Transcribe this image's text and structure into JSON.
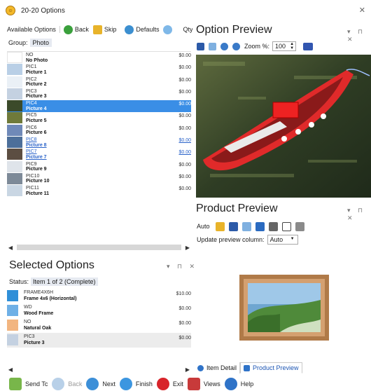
{
  "window": {
    "title": "20-20 Options"
  },
  "toolbar": {
    "tab": "Available Options",
    "back": "Back",
    "skip": "Skip",
    "defaults": "Defaults",
    "qty": "Qty"
  },
  "group": {
    "label": "Group:",
    "value": "Photo"
  },
  "available": [
    {
      "code": "NO",
      "name": "No Photo",
      "price": "$0.00",
      "thumb": "#ffffff",
      "state": ""
    },
    {
      "code": "PIC1",
      "name": "Picture 1",
      "price": "$0.00",
      "thumb": "#b9cfe6",
      "state": ""
    },
    {
      "code": "PIC2",
      "name": "Picture 2",
      "price": "$0.00",
      "thumb": "#eaf0f6",
      "state": ""
    },
    {
      "code": "PIC3",
      "name": "Picture 3",
      "price": "$0.00",
      "thumb": "#c4d1e1",
      "state": ""
    },
    {
      "code": "PIC4",
      "name": "Picture 4",
      "price": "$0.00",
      "thumb": "#3b4a2a",
      "state": "sel"
    },
    {
      "code": "PIC5",
      "name": "Picture 5",
      "price": "$0.00",
      "thumb": "#6f7a3a",
      "state": ""
    },
    {
      "code": "PIC6",
      "name": "Picture 6",
      "price": "$0.00",
      "thumb": "#6f89b8",
      "state": ""
    },
    {
      "code": "PIC8",
      "name": "Picture 8",
      "price": "$0.00",
      "thumb": "#4d6f9a",
      "state": "lnk"
    },
    {
      "code": "PIC7",
      "name": "Picture 7",
      "price": "$0.00",
      "thumb": "#5c4e42",
      "state": "lnk"
    },
    {
      "code": "PIC9",
      "name": "Picture 9",
      "price": "$0.00",
      "thumb": "#dfe4ea",
      "state": ""
    },
    {
      "code": "PIC10",
      "name": "Picture 10",
      "price": "$0.00",
      "thumb": "#7d8a98",
      "state": ""
    },
    {
      "code": "PIC11",
      "name": "Picture 11",
      "price": "$0.00",
      "thumb": "#c9d6e3",
      "state": ""
    }
  ],
  "selected": {
    "title": "Selected Options",
    "status_label": "Status:",
    "status_value": "Item 1 of 2 (Complete)",
    "items": [
      {
        "code": "FRAME4X6H",
        "name": "Frame 4x6 (Horizontal)",
        "price": "$10.00",
        "thumb": "#2f8fd8",
        "hl": false
      },
      {
        "code": "WD",
        "name": "Wood Frame",
        "price": "$0.00",
        "thumb": "#6fb0e6",
        "hl": false
      },
      {
        "code": "NO",
        "name": "Natural Oak",
        "price": "$0.00",
        "thumb": "#f2b580",
        "hl": false
      },
      {
        "code": "PIC3",
        "name": "Picture 3",
        "price": "$0.00",
        "thumb": "#c4d1e1",
        "hl": true
      }
    ]
  },
  "bottombar": {
    "send": "Send Tc",
    "back": "Back",
    "next": "Next",
    "finish": "Finish",
    "exit": "Exit",
    "views": "Views",
    "help": "Help"
  },
  "option_preview": {
    "title": "Option Preview",
    "zoom_label": "Zoom %:",
    "zoom_value": "100"
  },
  "product_preview": {
    "title": "Product Preview",
    "auto_label": "Auto",
    "update_label": "Update preview column:",
    "update_value": "Auto"
  },
  "tabs": {
    "item_detail": "Item Detail",
    "product_preview": "Product Preview"
  }
}
